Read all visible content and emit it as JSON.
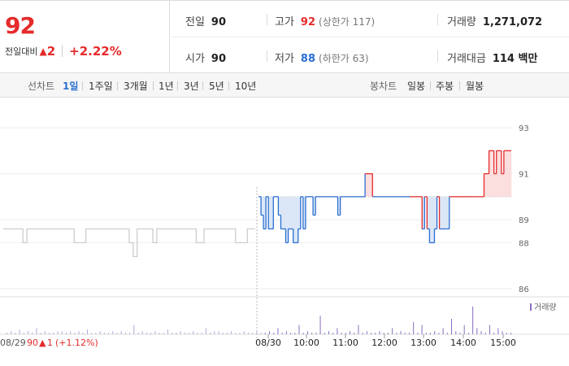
{
  "quote": {
    "price": "92",
    "change_label": "전일대비",
    "change_value": "2",
    "change_pct": "+2.22%",
    "prev_close": {
      "label": "전일",
      "value": "90"
    },
    "open": {
      "label": "시가",
      "value": "90"
    },
    "high": {
      "label": "고가",
      "value": "92",
      "limit": "(상한가 117)"
    },
    "low": {
      "label": "저가",
      "value": "88",
      "limit": "(하한가 63)"
    },
    "volume": {
      "label": "거래량",
      "value": "1,271,072"
    },
    "amount": {
      "label": "거래대금",
      "value": "114 백만"
    },
    "colors": {
      "up": "#e52b2b",
      "down": "#2b6fd1"
    }
  },
  "line_tabs": {
    "label": "선차트",
    "items": [
      "1일",
      "1주일",
      "3개월",
      "1년",
      "3년",
      "5년",
      "10년"
    ],
    "selected": "1일"
  },
  "candle_tabs": {
    "label": "봉차트",
    "items": [
      "일봉",
      "주봉",
      "월봉"
    ]
  },
  "chart_data": {
    "type": "line",
    "y_ticks": [
      "93",
      "91",
      "89",
      "88",
      "86"
    ],
    "time_labels": [
      "08/30",
      "10:00",
      "11:00",
      "12:00",
      "13:00",
      "14:00",
      "15:00"
    ],
    "prev_day": {
      "date": "08/29",
      "close": "90",
      "change": "1",
      "change_pct": "(+1.12%)"
    },
    "volume_legend": "거래량",
    "prev_day_series": [
      88.6,
      88.6,
      88.6,
      88.6,
      88.6,
      88,
      88.6,
      88.6,
      88.6,
      88.6,
      88.6,
      88.6,
      88.6,
      88.6,
      88.6,
      88.6,
      88.6,
      88.6,
      88,
      88,
      88,
      88.6,
      88.6,
      88.6,
      88.6,
      88.6,
      88.6,
      88.6,
      88.6,
      88.6,
      88.6,
      88.6,
      88,
      87.4,
      88.6,
      88.6,
      88.6,
      88.6,
      88,
      88.6,
      88.6,
      88.6,
      88.6,
      88.6,
      88.6,
      88.6,
      88.6,
      88.6,
      88.6,
      88,
      88,
      88.6,
      88.6,
      88.6,
      88.6,
      88.6,
      88.6,
      88.6,
      88.6,
      88,
      88,
      88,
      88.6,
      88.6,
      88.6
    ],
    "today_series": [
      90,
      89.2,
      88.6,
      90,
      88.6,
      88.6,
      90,
      90,
      89.2,
      88.6,
      88.6,
      88,
      88.6,
      88.6,
      88,
      88,
      88.6,
      90,
      88.6,
      90,
      90,
      90,
      89.2,
      90,
      90,
      90,
      90,
      90,
      90,
      90,
      90,
      90,
      89.2,
      90,
      90,
      90,
      90,
      90,
      90,
      90,
      90,
      90,
      90,
      91,
      91,
      91,
      90,
      90,
      90,
      90,
      90,
      90,
      90,
      90,
      90,
      90,
      90,
      90,
      90,
      90,
      90,
      90,
      90,
      90,
      90,
      90,
      88.6,
      90,
      88.6,
      88,
      88,
      88.6,
      90,
      88.6,
      88.6,
      88.6,
      88.6,
      90,
      90,
      90,
      90,
      90,
      90,
      90,
      90,
      90,
      90,
      90,
      90,
      90,
      90,
      91,
      91,
      92,
      92,
      91,
      92,
      92,
      91,
      92,
      92,
      92,
      92
    ],
    "volume_bars": [
      0.05,
      0.1,
      0.05,
      0.15,
      0.05,
      0.1,
      0.05,
      0.2,
      0.05,
      0.1,
      0.05,
      0.05,
      0.1,
      0.1,
      0.05,
      0.1,
      0.05,
      0.1,
      0.05,
      0.15,
      0.05,
      0.05,
      0.1,
      0.05,
      0.05,
      0.1,
      0.05,
      0.1,
      0.05,
      0.05,
      0.3,
      0.05,
      0.1,
      0.05,
      0.05,
      0.1,
      0.05,
      0.05,
      0.15,
      0.05,
      0.05,
      0.1,
      0.05,
      0.05,
      0.1,
      0.05,
      0.05,
      0.2,
      0.05,
      0.1,
      0.1,
      0.05,
      0.05,
      0.1,
      0.05,
      0.05,
      0.1,
      0.05,
      0.05,
      0.1,
      0.05,
      0.05,
      0.1,
      0.05,
      0.2,
      0.05,
      0.1,
      0.05,
      0.05,
      0.3,
      0.05,
      0.1,
      0.05,
      0.05,
      0.6,
      0.05,
      0.1,
      0.05,
      0.2,
      0.05,
      0.05,
      0.1,
      0.05,
      0.3,
      0.05,
      0.1,
      0.05,
      0.05,
      0.1,
      0.05,
      0.05,
      0.2,
      0.05,
      0.1,
      0.05,
      0.05,
      0.4,
      0.05,
      0.3,
      0.05,
      0.05,
      0.1,
      0.05,
      0.2,
      0.05,
      0.5,
      0.1,
      0.05,
      0.3,
      0.05,
      0.9,
      0.2,
      0.1,
      0.05,
      0.3,
      0.05,
      0.2,
      0.1,
      0.05,
      0.05
    ]
  }
}
